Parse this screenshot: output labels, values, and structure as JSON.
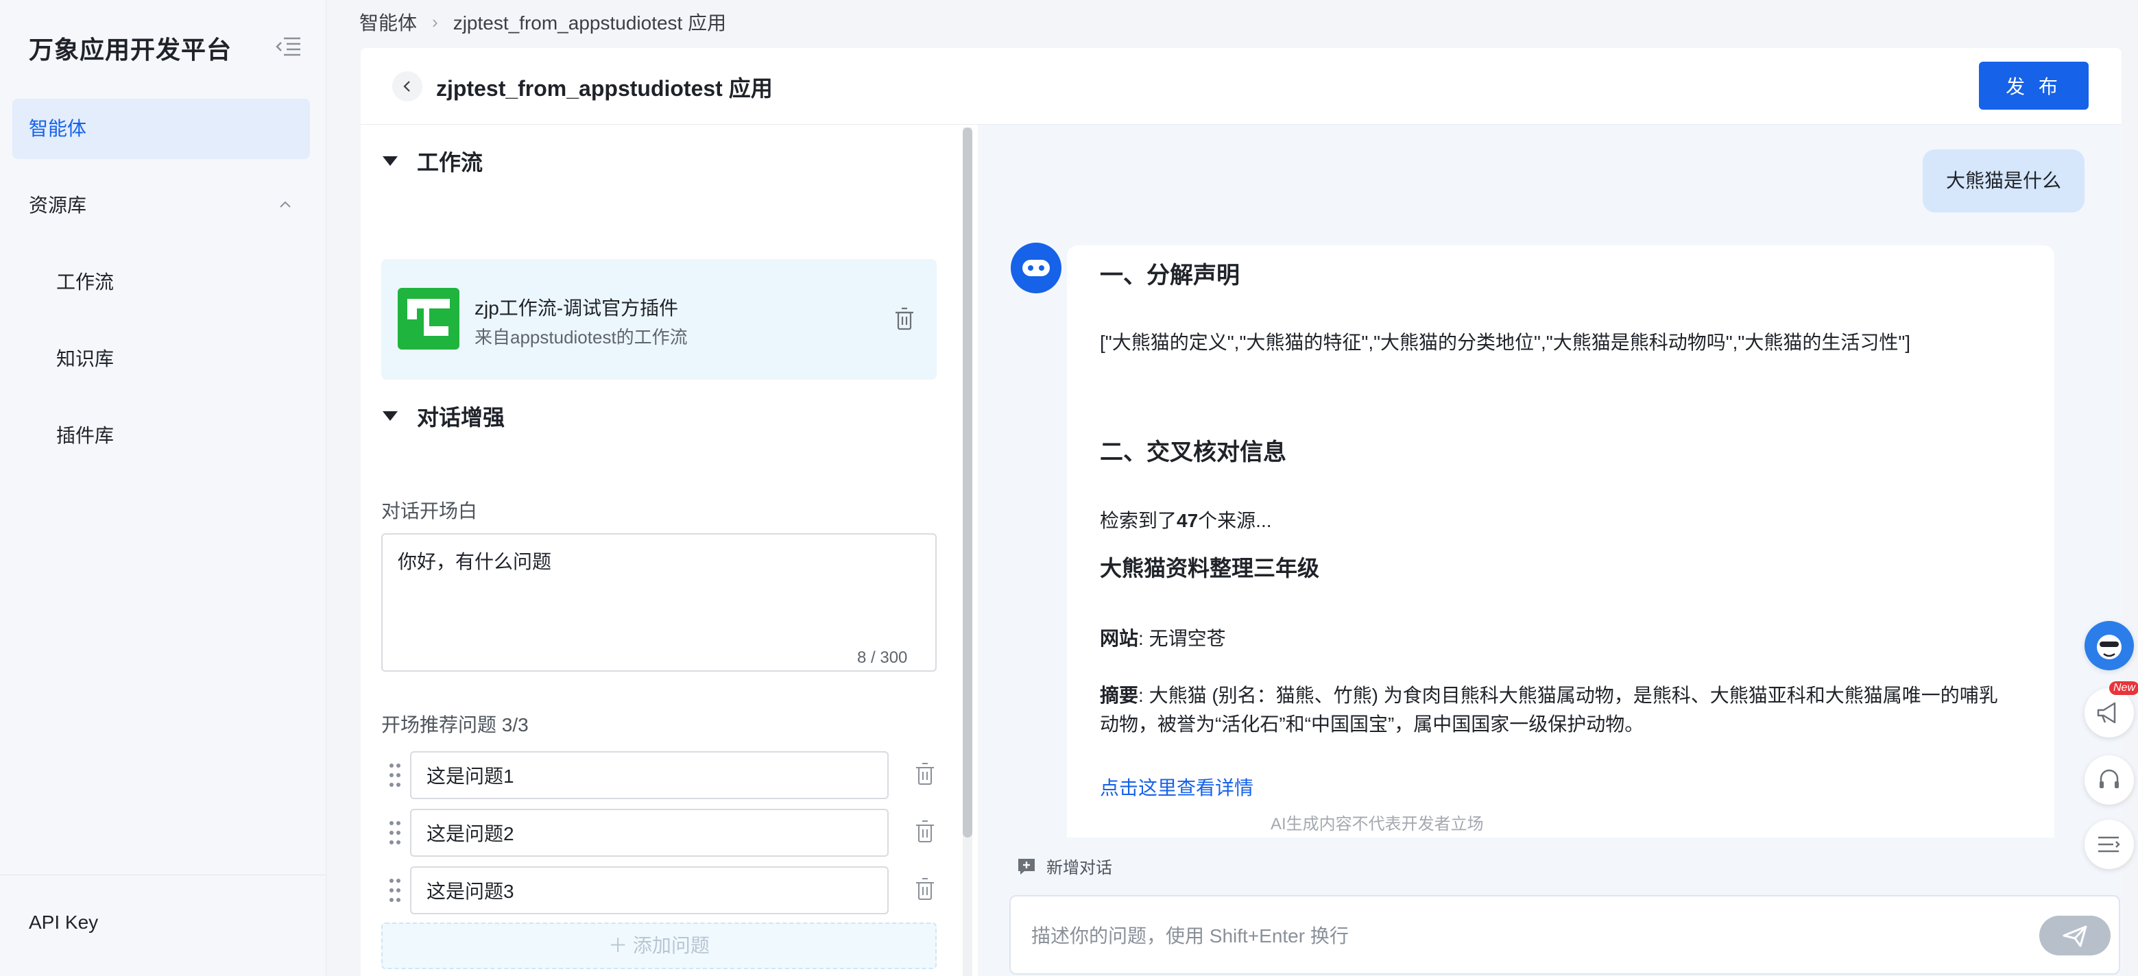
{
  "sidebar": {
    "brand": "万象应用开发平台",
    "items": [
      {
        "label": "智能体"
      },
      {
        "label": "资源库"
      },
      {
        "label": "工作流"
      },
      {
        "label": "知识库"
      },
      {
        "label": "插件库"
      }
    ],
    "api_key": "API Key"
  },
  "breadcrumb": [
    "智能体",
    "zjptest_from_appstudiotest 应用"
  ],
  "header": {
    "title": "zjptest_from_appstudiotest 应用",
    "publish": "发 布"
  },
  "config": {
    "workflow_section": "工作流",
    "workflow": {
      "name": "zjp工作流-调试官方插件",
      "from": "来自appstudiotest的工作流"
    },
    "dialog_section": "对话增强",
    "opening_label": "对话开场白",
    "opening_value": "你好，有什么问题",
    "char_count": "8 / 300",
    "suggest_label": "开场推荐问题 3/3",
    "questions": [
      "这是问题1",
      "这是问题2",
      "这是问题3"
    ],
    "add_question": "添加问题"
  },
  "chat": {
    "user_message": "大熊猫是什么",
    "h1": "一、分解声明",
    "decomposition": "[\"大熊猫的定义\",\"大熊猫的特征\",\"大熊猫的分类地位\",\"大熊猫是熊科动物吗\",\"大熊猫的生活习性\"]",
    "h2": "二、交叉核对信息",
    "sources_prefix": "检索到了",
    "sources_count": "47",
    "sources_suffix": "个来源...",
    "result_title": "大熊猫资料整理三年级",
    "site_label": "网站",
    "site_value": ": 无谓空苍",
    "summary_label": "摘要",
    "summary_value": ": 大熊猫 (别名：猫熊、竹熊) 为食肉目熊科大熊猫属动物，是熊科、大熊猫亚科和大熊猫属唯一的哺乳动物，被誉为“活化石”和“中国国宝”，属中国国家一级保护动物。",
    "detail_link": "点击这里查看详情",
    "new_chat": "新增对话",
    "disclaimer": "AI生成内容不代表开发者立场",
    "input_placeholder": "描述你的问题，使用 Shift+Enter 换行"
  },
  "float": {
    "badge": "New"
  },
  "colors": {
    "accent": "#1662e8",
    "workflow_icon": "#1eb43e",
    "active_nav_bg": "#e3edfc"
  }
}
